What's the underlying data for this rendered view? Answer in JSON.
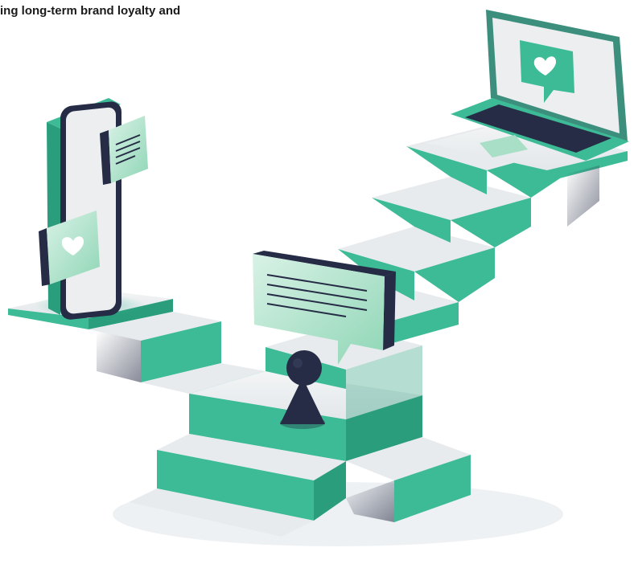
{
  "headline": {
    "text": "ing long-term brand loyalty and"
  },
  "illustration": {
    "icons": [
      "smartphone-icon",
      "laptop-icon",
      "heart-icon",
      "chat-bubble-icon",
      "person-figure-icon"
    ],
    "colors": {
      "teal": "#3dbb96",
      "teal_dark": "#2a9e7c",
      "teal_light": "#a8dfc6",
      "navy": "#262c45",
      "light_gray": "#e9ecef",
      "screen": "#eceef0"
    }
  }
}
